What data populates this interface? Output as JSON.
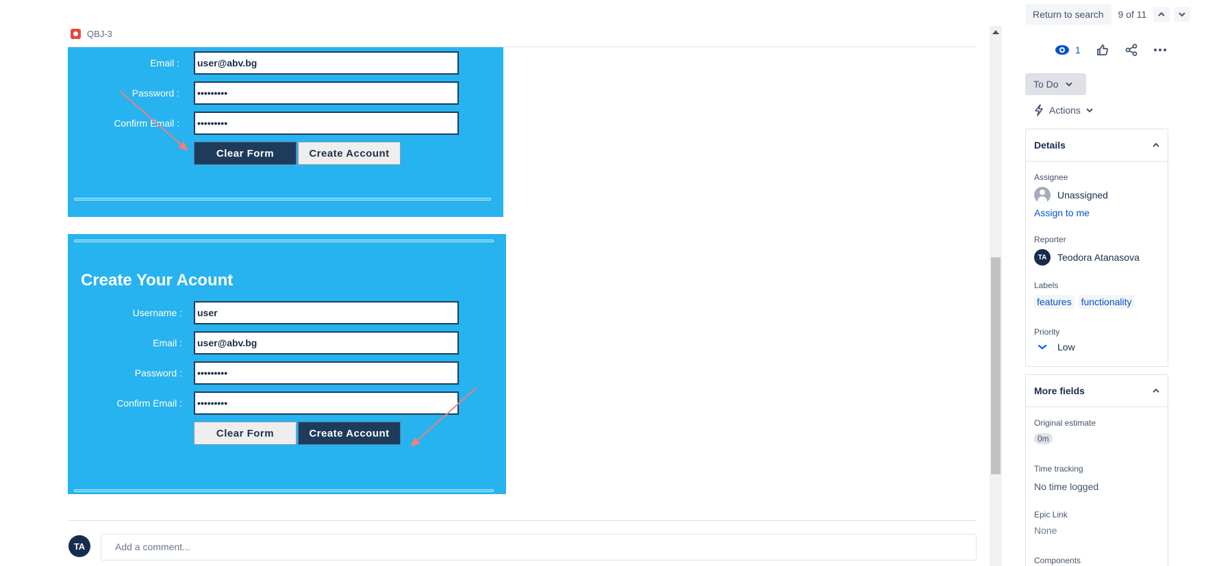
{
  "issue": {
    "key": "QBJ-3"
  },
  "form_top": {
    "email_label": "Email :",
    "email_value": "user@abv.bg",
    "password_label": "Password :",
    "password_value": "•••••••••",
    "confirm_label": "Confirm Email :",
    "confirm_value": "•••••••••",
    "clear_label": "Clear Form",
    "create_label": "Create Account"
  },
  "form_bottom": {
    "title": "Create Your Acount",
    "username_label": "Username :",
    "username_value": "user",
    "email_label": "Email :",
    "email_value": "user@abv.bg",
    "password_label": "Password :",
    "password_value": "•••••••••",
    "confirm_label": "Confirm Email :",
    "confirm_value": "•••••••••",
    "clear_label": "Clear Form",
    "create_label": "Create Account"
  },
  "comment": {
    "avatar_initials": "TA",
    "placeholder": "Add a comment..."
  },
  "nav": {
    "return_label": "Return to search",
    "position": "9 of 11"
  },
  "actions_bar": {
    "watch_count": "1"
  },
  "status": {
    "label": "To Do"
  },
  "actions": {
    "label": "Actions"
  },
  "details": {
    "header": "Details",
    "assignee_label": "Assignee",
    "assignee_value": "Unassigned",
    "assign_to_me": "Assign to me",
    "reporter_label": "Reporter",
    "reporter_initials": "TA",
    "reporter_value": "Teodora Atanasova",
    "labels_label": "Labels",
    "labels": [
      "features",
      "functionality"
    ],
    "priority_label": "Priority",
    "priority_value": "Low"
  },
  "more_fields": {
    "header": "More fields",
    "original_estimate_label": "Original estimate",
    "original_estimate_value": "0m",
    "time_tracking_label": "Time tracking",
    "time_tracking_value": "No time logged",
    "epic_link_label": "Epic Link",
    "epic_link_value": "None",
    "components_label": "Components"
  },
  "colors": {
    "brand_blue": "#0052cc",
    "panel_blue": "#27b3ef",
    "dark_button": "#1f3b5c",
    "bug_red": "#e5493a"
  }
}
